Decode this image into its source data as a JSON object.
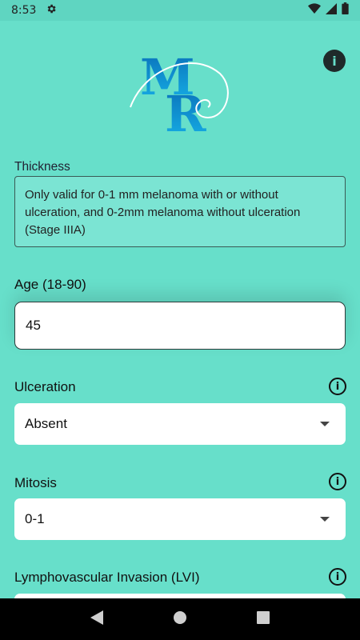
{
  "status_bar": {
    "time": "8:53"
  },
  "logo": {
    "text": "MR"
  },
  "thickness": {
    "label": "Thickness",
    "note": "Only valid for 0-1 mm melanoma with or without ulceration, and 0-2mm melanoma without ulceration (Stage IIIA)"
  },
  "age": {
    "label": "Age (18-90)",
    "value": "45"
  },
  "ulceration": {
    "label": "Ulceration",
    "value": "Absent"
  },
  "mitosis": {
    "label": "Mitosis",
    "value": "0-1"
  },
  "lvi": {
    "label": "Lymphovascular Invasion (LVI)"
  },
  "colors": {
    "background": "#67DFCA",
    "logo_blue": "#0a8fd6",
    "field": "#FFFFFF"
  },
  "icons": [
    "settings-icon",
    "wifi-icon",
    "signal-icon",
    "battery-icon",
    "info-icon",
    "back-icon",
    "home-icon",
    "recents-icon",
    "dropdown-caret-icon"
  ]
}
